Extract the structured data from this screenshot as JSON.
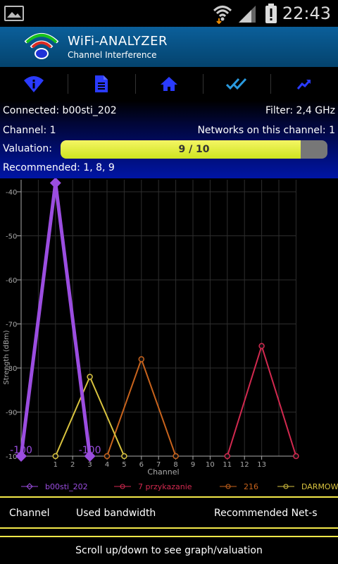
{
  "status_bar": {
    "time": "22:43",
    "icons": [
      "image-icon",
      "wifi-icon",
      "signal-icon",
      "alert-battery-icon"
    ]
  },
  "app_bar": {
    "title": "WiFi-ANALYZER",
    "subtitle": "Channel Interference"
  },
  "toolbar": {
    "icons": [
      "wifi-info-icon",
      "document-icon",
      "home-icon",
      "double-check-icon",
      "trend-icon"
    ]
  },
  "info": {
    "connected": "Connected: b00sti_202",
    "filter": "Filter: 2,4 GHz",
    "channel": "Channel: 1",
    "networks": "Networks on this channel: 1",
    "valuation_label": "Valuation:",
    "valuation_text": "9 / 10",
    "valuation_value": 0.9,
    "recommended": "Recommended: 1, 8, 9"
  },
  "chart_data": {
    "type": "line",
    "xlabel": "Channel",
    "ylabel": "Strength (dBm)",
    "ylim": [
      -100,
      -40
    ],
    "y_ticks": [
      -40,
      -50,
      -60,
      -70,
      -80,
      -90,
      -100
    ],
    "x_ticks": [
      "1",
      "2",
      "3",
      "4",
      "5",
      "6",
      "7",
      "8",
      "9",
      "10",
      "11",
      "12",
      "13"
    ],
    "grid": true,
    "legend_position": "bottom",
    "series": [
      {
        "name": "b00sti_202",
        "color": "#9b4de0",
        "points": [
          [
            -1,
            -100
          ],
          [
            1,
            -38
          ],
          [
            3,
            -100
          ]
        ],
        "labels": [
          "-100",
          "",
          "-100"
        ]
      },
      {
        "name": "7 przykazanie",
        "color": "#d2294f",
        "points": [
          [
            11,
            -100
          ],
          [
            13,
            -75
          ],
          [
            15,
            -100
          ]
        ]
      },
      {
        "name": "216",
        "color": "#c8631c",
        "points": [
          [
            4,
            -100
          ],
          [
            6,
            -78
          ],
          [
            8,
            -100
          ]
        ]
      },
      {
        "name": "DARMOWY",
        "color": "#d9c33f",
        "points": [
          [
            1,
            -100
          ],
          [
            3,
            -82
          ],
          [
            5,
            -100
          ]
        ]
      }
    ]
  },
  "tabs": {
    "channel": "Channel",
    "used_bandwidth": "Used bandwidth",
    "recommended": "Recommended Net-s"
  },
  "footer": {
    "scroll_hint": "Scroll up/down to see graph/valuation"
  }
}
